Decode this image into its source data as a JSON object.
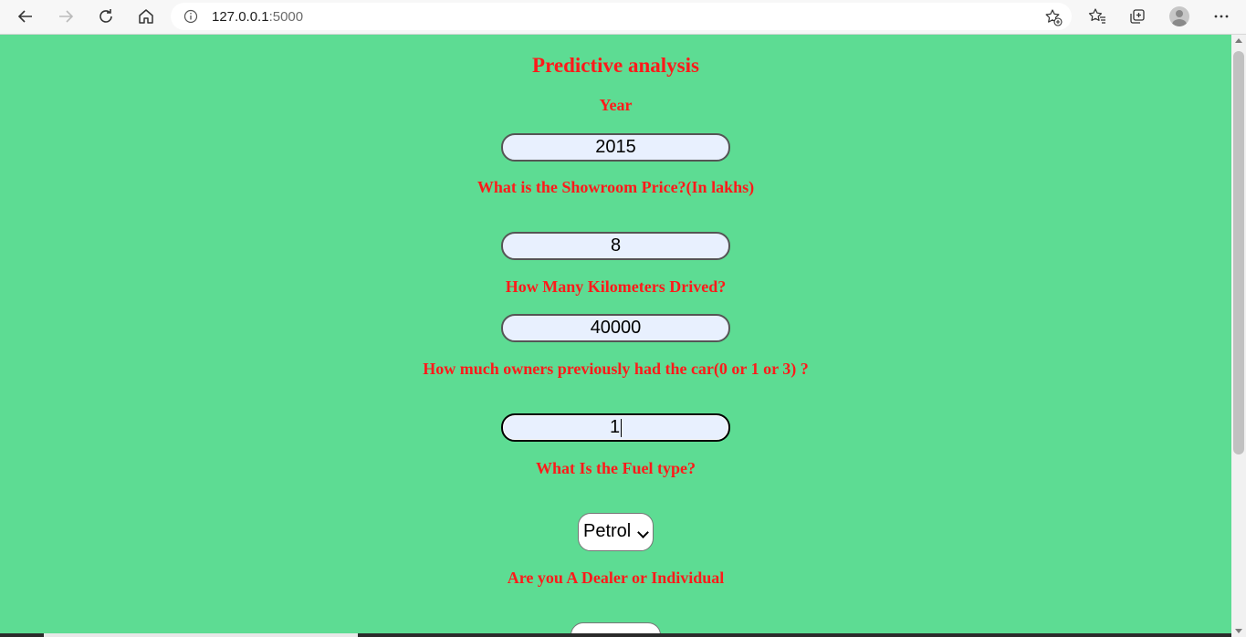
{
  "browser": {
    "url_host": "127.0.0.1",
    "url_port": ":5000",
    "icons": [
      "back-icon",
      "forward-icon",
      "reload-icon",
      "home-icon",
      "site-info-icon",
      "add-favorite-icon",
      "favorites-icon",
      "collections-icon",
      "profile-icon",
      "more-icon"
    ]
  },
  "form": {
    "title": "Predictive analysis",
    "year_label": "Year",
    "year_value": "2015",
    "price_label": "What is the Showroom Price?(In lakhs)",
    "price_value": "8",
    "km_label": "How Many Kilometers Drived?",
    "km_value": "40000",
    "owners_label": "How much owners previously had the car(0 or 1 or 3) ?",
    "owners_value": "1",
    "fuel_label": "What Is the Fuel type?",
    "fuel_value": "Petrol",
    "seller_label": "Are you A Dealer or Individual"
  },
  "colors": {
    "background": "#5ddc93",
    "label": "#ff1a1a",
    "input_fill": "#e8f0fe"
  }
}
